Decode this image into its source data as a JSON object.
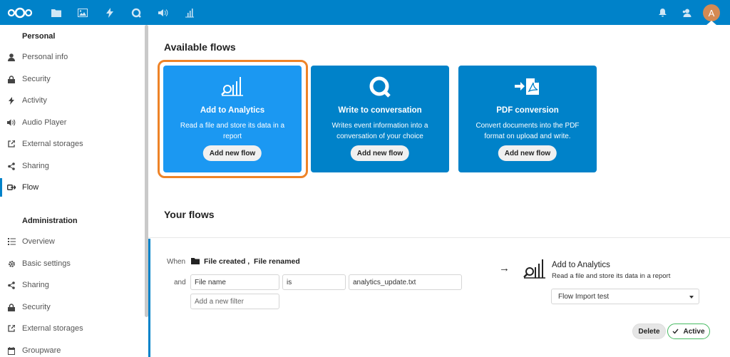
{
  "header": {
    "apps": [
      "files-icon",
      "photos-icon",
      "activity-icon",
      "talk-icon",
      "audio-player-icon",
      "analytics-icon"
    ],
    "avatar_letter": "A",
    "brand_color": "#0082c9"
  },
  "sidebar": {
    "personal_heading": "Personal",
    "personal_items": [
      {
        "label": "Personal info",
        "icon": "person-icon"
      },
      {
        "label": "Security",
        "icon": "lock-icon"
      },
      {
        "label": "Activity",
        "icon": "activity-icon"
      },
      {
        "label": "Audio Player",
        "icon": "speaker-icon"
      },
      {
        "label": "External storages",
        "icon": "external-icon"
      },
      {
        "label": "Sharing",
        "icon": "share-icon"
      },
      {
        "label": "Flow",
        "icon": "flow-icon",
        "active": true
      }
    ],
    "admin_heading": "Administration",
    "admin_items": [
      {
        "label": "Overview",
        "icon": "list-icon"
      },
      {
        "label": "Basic settings",
        "icon": "gear-icon"
      },
      {
        "label": "Sharing",
        "icon": "share-icon"
      },
      {
        "label": "Security",
        "icon": "lock-icon"
      },
      {
        "label": "External storages",
        "icon": "external-icon"
      },
      {
        "label": "Groupware",
        "icon": "groupware-icon"
      }
    ]
  },
  "available_flows": {
    "title": "Available flows",
    "cards": [
      {
        "title": "Add to Analytics",
        "description": "Read a file and store its data in a report",
        "button": "Add new flow",
        "icon": "analytics-icon"
      },
      {
        "title": "Write to conversation",
        "description": "Writes event information into a conversation of your choice",
        "button": "Add new flow",
        "icon": "talk-icon"
      },
      {
        "title": "PDF conversion",
        "description": "Convert documents into the PDF format on upload and write.",
        "button": "Add new flow",
        "icon": "pdf-icon"
      }
    ]
  },
  "your_flows": {
    "title": "Your flows",
    "rule": {
      "when_label": "When",
      "events": "File created ,  File renamed",
      "and_label": "and",
      "filter_field": "File name",
      "filter_operator": "is",
      "filter_value": "analytics_update.txt",
      "add_filter_placeholder": "Add a new filter",
      "arrow": "→",
      "operation_title": "Add to Analytics",
      "operation_desc": "Read a file and store its data in a report",
      "selected_report": "Flow Import test",
      "delete_label": "Delete",
      "active_label": "Active"
    }
  }
}
